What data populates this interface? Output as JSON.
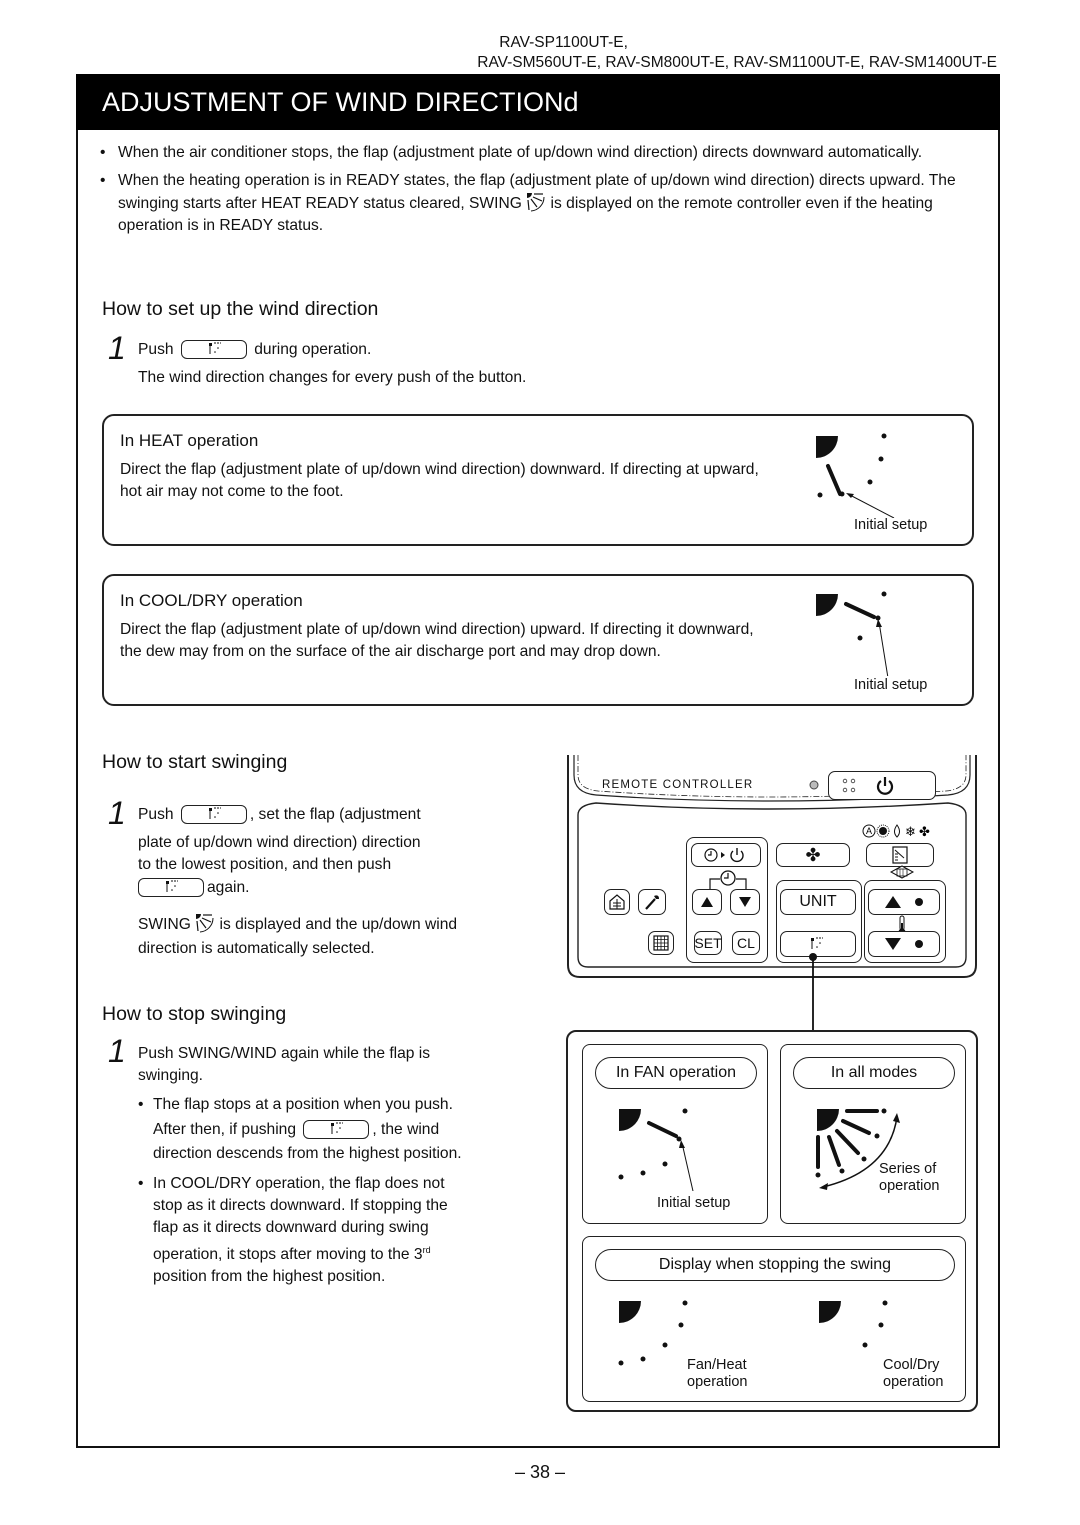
{
  "header": {
    "models_line1": "RAV-SP1100UT-E,",
    "models_line2": "RAV-SM560UT-E, RAV-SM800UT-E, RAV-SM1100UT-E, RAV-SM1400UT-E",
    "title": "ADJUSTMENT OF WIND DIRECTIONd"
  },
  "intro_bullets": [
    "When the air conditioner stops, the flap (adjustment plate of up/down wind direction) directs downward automatically.",
    {
      "before": "When the heating operation is in READY states, the flap (adjustment plate of up/down wind direction) directs upward. The swinging starts after HEAT READY status cleared, SWING",
      "icon": "swing-icon",
      "after": "is displayed on the remote controller even if the heating operation is in READY status."
    }
  ],
  "setup": {
    "heading": "How to set up the wind direction",
    "step_number": "1",
    "push_label": "Push",
    "push_after": "during operation.",
    "note": "The wind direction changes for every push of the button.",
    "button_icon": "swing-wind-button-icon",
    "heat_box": {
      "title": "In HEAT operation",
      "text": "Direct the flap (adjustment plate of up/down wind direction) downward. If directing at upward, hot air may not come to the foot.",
      "caption": "Initial setup"
    },
    "cool_box": {
      "title": "In COOL/DRY operation",
      "text": "Direct the flap (adjustment plate of up/down wind direction) upward. If directing it downward, the dew may from on the surface of the air discharge port and may drop down.",
      "caption": "Initial setup"
    }
  },
  "start_swing": {
    "heading": "How to start swinging",
    "step_number": "1",
    "push_label": "Push",
    "text_after_first_button": ", set the flap (adjustment",
    "line2": "plate of up/down wind direction) direction",
    "line3": "to the lowest position, and then push",
    "again": "again.",
    "swing_before": "SWING",
    "swing_after": "is displayed and the up/down wind",
    "swing_line2": "direction is automatically selected."
  },
  "stop_swing": {
    "heading": "How to stop swinging",
    "step_number": "1",
    "line1": "Push SWING/WIND again while the flap is",
    "line2": "swinging.",
    "bullet1_line1": "The flap stops at a position when you push.",
    "bullet1_before": "After then, if pushing",
    "bullet1_after": ", the wind",
    "bullet1_line3": "direction descends from the highest position.",
    "bullet2_lines": [
      "In COOL/DRY operation, the flap does not",
      "stop as it directs downward. If stopping the",
      "flap as it directs downward during swing",
      "operation, it stops after moving to the 3"
    ],
    "bullet2_sup": "rd",
    "bullet2_last": "position from the highest position."
  },
  "remote": {
    "label": "REMOTE CONTROLLER",
    "buttons": {
      "timer_off": "timer-to-off",
      "fan": "fan",
      "mode": "mode",
      "ventilation": "ventilation",
      "maintenance": "maintenance",
      "time_up": "time-up",
      "time_down": "time-down",
      "unit": "UNIT",
      "temp_up": "temp-up",
      "temp_down": "temp-down",
      "schedule": "schedule",
      "set": "SET",
      "cl": "CL",
      "swing": "swing-wind"
    }
  },
  "diagrams": {
    "fan_label": "In FAN operation",
    "fan_caption": "Initial setup",
    "all_modes_label": "In all modes",
    "series_caption_1": "Series of",
    "series_caption_2": "operation",
    "stop_display_label": "Display when stopping the swing",
    "fan_heat_1": "Fan/Heat",
    "fan_heat_2": "operation",
    "cool_dry_1": "Cool/Dry",
    "cool_dry_2": "operation"
  },
  "footer": {
    "page_number": "– 38 –"
  }
}
